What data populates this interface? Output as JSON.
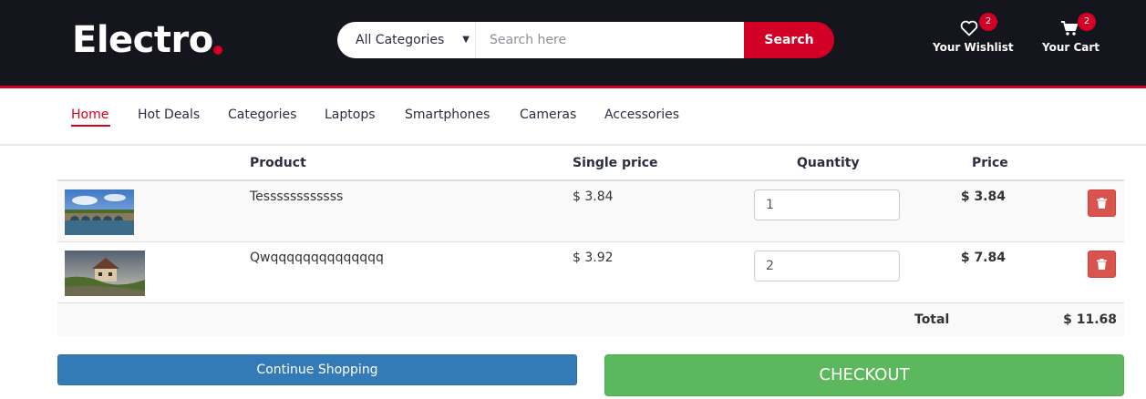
{
  "brand": {
    "logo_text": "Electro",
    "accent_color": "#d10024",
    "header_bg": "#15161d"
  },
  "search": {
    "category_selected": "All Categories",
    "placeholder": "Search here",
    "button_label": "Search"
  },
  "header_links": {
    "wishlist": {
      "icon": "heart-icon",
      "label": "Your Wishlist",
      "count": "2"
    },
    "cart": {
      "icon": "cart-icon",
      "label": "Your Cart",
      "count": "2"
    }
  },
  "nav": {
    "items": [
      "Home",
      "Hot Deals",
      "Categories",
      "Laptops",
      "Smartphones",
      "Cameras",
      "Accessories"
    ],
    "active": "Home"
  },
  "cart_table": {
    "headers": {
      "product": "Product",
      "single_price": "Single price",
      "quantity": "Quantity",
      "price": "Price"
    },
    "rows": [
      {
        "name": "Tessssssssssss",
        "single_price": "$ 3.84",
        "quantity": "1",
        "line_price": "$ 3.84",
        "thumb": "bridge-photo"
      },
      {
        "name": "Qwqqqqqqqqqqqqqq",
        "single_price": "$ 3.92",
        "quantity": "2",
        "line_price": "$ 7.84",
        "thumb": "house-photo"
      }
    ],
    "total_label": "Total",
    "total_value": "$ 11.68"
  },
  "actions": {
    "continue_label": "Continue Shopping",
    "checkout_label": "CHECKOUT",
    "continue_color": "#337ab7",
    "checkout_color": "#5cb85c",
    "delete_color": "#d9534f"
  }
}
